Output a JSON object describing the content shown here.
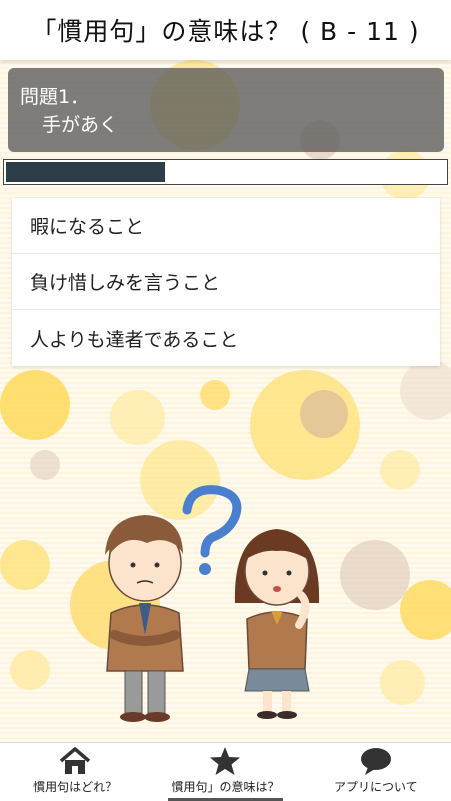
{
  "header": {
    "title": "「慣用句」の意味は？ ( B - 11 )"
  },
  "question": {
    "number": "問題1．",
    "text": "手があく"
  },
  "progress": {
    "fraction": 0.36
  },
  "choices": [
    {
      "label": "暇になること"
    },
    {
      "label": "負け惜しみを言うこと"
    },
    {
      "label": "人よりも達者であること"
    }
  ],
  "bottom_nav": [
    {
      "label": "慣用句はどれ？",
      "icon": "home-icon"
    },
    {
      "label": "慣用句」の意味は？",
      "icon": "star-icon",
      "active": true
    },
    {
      "label": "アプリについて",
      "icon": "speech-bubble-icon"
    }
  ],
  "colors": {
    "progress_fill": "#2e3e48",
    "question_bg": "#5a5a5a",
    "dots_yellow": "#ffd95a",
    "dots_brown": "#d7b6a0"
  }
}
